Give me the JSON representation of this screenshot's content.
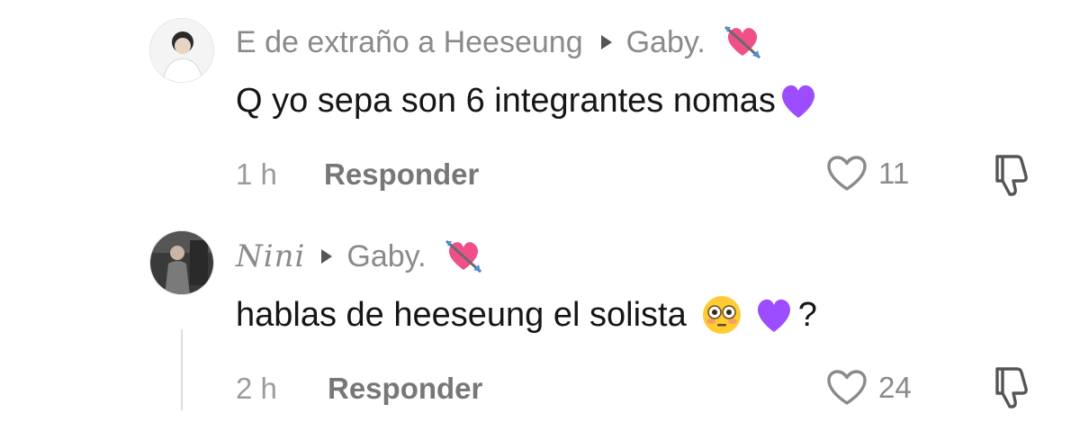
{
  "comments": [
    {
      "author": "E de extraño a Heeseung",
      "reply_to": "Gaby.",
      "reply_to_emoji": "cupid-heart-emoji",
      "text": "Q yo sepa son 6 integrantes nomas",
      "text_emoji": "purple-heart-emoji",
      "time": "1 h",
      "reply_label": "Responder",
      "likes": "11"
    },
    {
      "author": "Nini",
      "reply_to": "Gaby.",
      "reply_to_emoji": "cupid-heart-emoji",
      "text": "hablas de heeseung el solista",
      "text_emojis": [
        "flushed-face-emoji",
        "purple-heart-emoji"
      ],
      "text_suffix": "?",
      "time": "2 h",
      "reply_label": "Responder",
      "likes": "24"
    }
  ],
  "colors": {
    "meta_gray": "#8a8a8a",
    "text": "#161616",
    "purple_heart": "#9b4dff",
    "cupid_pink": "#f0508a"
  }
}
